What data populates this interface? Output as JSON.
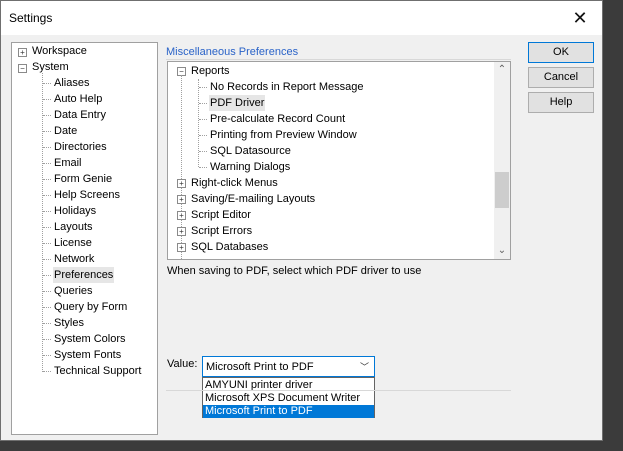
{
  "window": {
    "title": "Settings"
  },
  "buttons": {
    "ok": "OK",
    "cancel": "Cancel",
    "help": "Help"
  },
  "left_tree": {
    "workspace": "Workspace",
    "system": "System",
    "items": [
      "Aliases",
      "Auto Help",
      "Data Entry",
      "Date",
      "Directories",
      "Email",
      "Form Genie",
      "Help Screens",
      "Holidays",
      "Layouts",
      "License",
      "Network",
      "Preferences",
      "Queries",
      "Query by Form",
      "Styles",
      "System Colors",
      "System Fonts",
      "Technical Support"
    ],
    "selected": "Preferences"
  },
  "group": {
    "title": "Miscellaneous Preferences"
  },
  "pref_tree": {
    "reports": "Reports",
    "report_children": [
      "No Records in Report Message",
      "PDF Driver",
      "Pre-calculate Record Count",
      "Printing from Preview Window",
      "SQL Datasource",
      "Warning Dialogs"
    ],
    "selected": "PDF Driver",
    "others": [
      "Right-click Menus",
      "Saving/E-mailing Layouts",
      "Script Editor",
      "Script Errors",
      "SQL Databases"
    ]
  },
  "description": "When saving to PDF, select which PDF driver to use",
  "value": {
    "label": "Value:",
    "selected": "Microsoft Print to PDF",
    "options": [
      "AMYUNI printer driver",
      "Microsoft XPS Document Writer",
      "Microsoft Print to PDF"
    ]
  }
}
